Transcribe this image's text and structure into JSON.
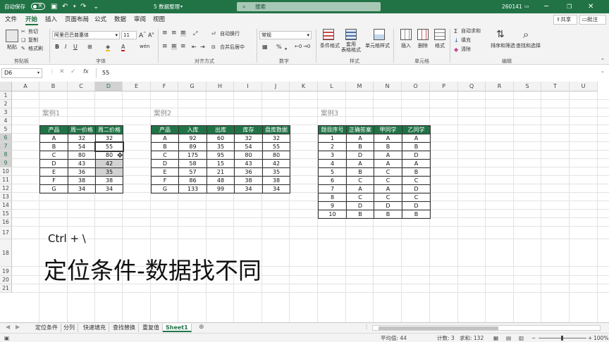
{
  "titlebar": {
    "autosave_label": "自动保存",
    "autosave_state": "关",
    "filename": "5 数据整理",
    "search_placeholder": "搜索",
    "user": "260141"
  },
  "menubar": {
    "tabs": [
      "文件",
      "开始",
      "插入",
      "页面布局",
      "公式",
      "数据",
      "审阅",
      "视图"
    ],
    "active_tab": "开始",
    "share_label": "共享",
    "comment_label": "批注"
  },
  "ribbon": {
    "clipboard": {
      "paste": "粘贴",
      "cut": "剪切",
      "copy": "复制",
      "format_painter": "格式刷",
      "group": "剪贴板"
    },
    "font": {
      "family": "阿里巴巴普惠体",
      "size": "11",
      "group": "字体"
    },
    "alignment": {
      "wrap": "自动换行",
      "merge": "合并后居中",
      "group": "对齐方式"
    },
    "number": {
      "format": "常规",
      "group": "数字"
    },
    "styles": {
      "conditional": "条件格式",
      "table": "套用\n表格格式",
      "cell_styles": "单元格样式",
      "group": "样式"
    },
    "cells": {
      "insert": "插入",
      "delete": "删除",
      "format": "格式",
      "group": "单元格"
    },
    "editing": {
      "autosum": "自动求和",
      "fill": "填充",
      "clear": "清除",
      "sort": "排序和筛选",
      "find": "查找和选择",
      "group": "编辑"
    }
  },
  "formula": {
    "namebox": "D6",
    "value": "55"
  },
  "columns": [
    "A",
    "B",
    "C",
    "D",
    "E",
    "F",
    "G",
    "H",
    "I",
    "J",
    "K",
    "L",
    "M",
    "N",
    "O",
    "P",
    "Q",
    "R",
    "S",
    "T",
    "U"
  ],
  "rows": [
    "1",
    "2",
    "3",
    "4",
    "5",
    "6",
    "7",
    "8",
    "9",
    "10",
    "11",
    "12",
    "13",
    "14",
    "15",
    "16",
    "17",
    "18",
    "19",
    "20",
    "21"
  ],
  "case1": {
    "title": "案例1",
    "headers": [
      "产品",
      "周一价格",
      "周二价格"
    ],
    "rows": [
      [
        "A",
        "32",
        "32"
      ],
      [
        "B",
        "54",
        "55"
      ],
      [
        "C",
        "80",
        "80"
      ],
      [
        "D",
        "43",
        "42"
      ],
      [
        "E",
        "36",
        "35"
      ],
      [
        "F",
        "38",
        "38"
      ],
      [
        "G",
        "34",
        "34"
      ]
    ]
  },
  "case2": {
    "title": "案例2",
    "headers": [
      "产品",
      "入库",
      "出库",
      "库存",
      "盘库数据"
    ],
    "rows": [
      [
        "A",
        "92",
        "60",
        "32",
        "32"
      ],
      [
        "B",
        "89",
        "35",
        "54",
        "55"
      ],
      [
        "C",
        "175",
        "95",
        "80",
        "80"
      ],
      [
        "D",
        "58",
        "15",
        "43",
        "42"
      ],
      [
        "E",
        "57",
        "21",
        "36",
        "35"
      ],
      [
        "F",
        "86",
        "48",
        "38",
        "38"
      ],
      [
        "G",
        "133",
        "99",
        "34",
        "34"
      ]
    ]
  },
  "case3": {
    "title": "案例3",
    "headers": [
      "题目序号",
      "正确答案",
      "甲同学",
      "乙同学"
    ],
    "rows": [
      [
        "1",
        "A",
        "A",
        "A"
      ],
      [
        "2",
        "B",
        "B",
        "B"
      ],
      [
        "3",
        "D",
        "A",
        "D"
      ],
      [
        "4",
        "A",
        "A",
        "A"
      ],
      [
        "5",
        "B",
        "C",
        "B"
      ],
      [
        "6",
        "C",
        "C",
        "C"
      ],
      [
        "7",
        "A",
        "A",
        "D"
      ],
      [
        "8",
        "C",
        "C",
        "C"
      ],
      [
        "9",
        "D",
        "D",
        "D"
      ],
      [
        "10",
        "B",
        "B",
        "B"
      ]
    ]
  },
  "overlay": {
    "shortcut": "Ctrl + \\",
    "caption": "定位条件-数据找不同"
  },
  "sheets": [
    "定位条件",
    "分列",
    "快速填充",
    "查找替换",
    "重复值",
    "Sheet1"
  ],
  "active_sheet": "Sheet1",
  "status": {
    "average": "平均值: 44",
    "count": "计数: 3",
    "sum": "求和: 132",
    "zoom": "100%"
  },
  "colors": {
    "excel_green": "#217346",
    "header_fill": "#217346",
    "selection_gray": "#d2d2d2"
  }
}
